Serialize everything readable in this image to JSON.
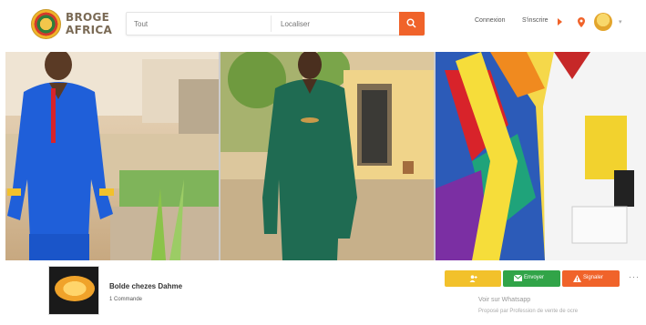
{
  "header": {
    "logo_text": "BROGE AFRICA",
    "search_placeholder": "Tout",
    "location_placeholder": "Localiser",
    "nav": [
      "Connexion",
      "S'inscrire"
    ]
  },
  "banner": {
    "photos": [
      {
        "alt": "Blue outfit"
      },
      {
        "alt": "Green outfit"
      },
      {
        "alt": "Printed shirt"
      }
    ]
  },
  "shop": {
    "name": "Bolde chezes Dahme",
    "subtitle": "1 Commande",
    "address_line1": "Voir sur Whatsapp",
    "address_line2": "Proposé par Profession de vente de ocre"
  },
  "actions": {
    "follow_icon": "user-plus-icon",
    "contact_label": "Envoyer",
    "report_label": "Signaler",
    "more_label": "···"
  },
  "colors": {
    "accent": "#f0632a",
    "yellow": "#f2c12b",
    "green": "#31a448"
  }
}
